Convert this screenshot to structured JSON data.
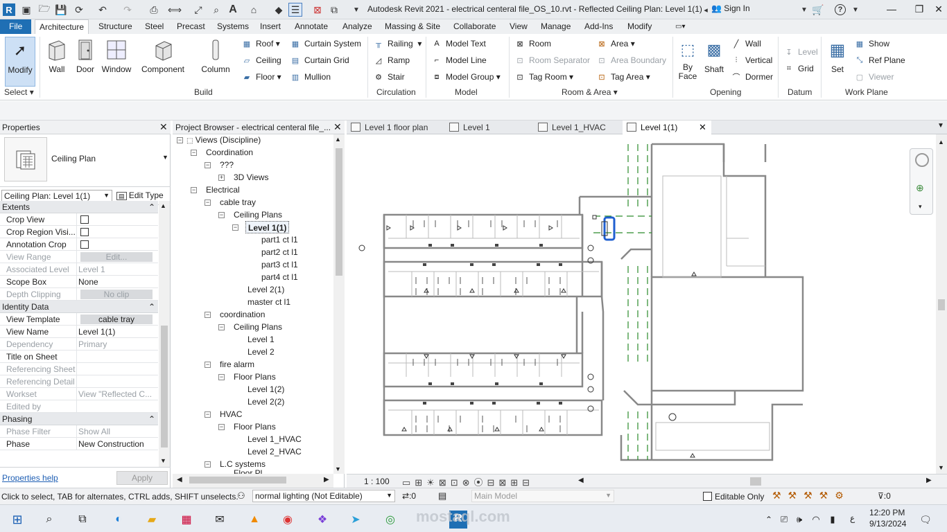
{
  "window": {
    "title": "Autodesk Revit 2021 - electrical centeral file_OS_10.rvt - Reflected Ceiling Plan: Level 1(1)",
    "signin": "Sign In"
  },
  "ribbon_tabs": [
    "File",
    "Architecture",
    "Structure",
    "Steel",
    "Precast",
    "Systems",
    "Insert",
    "Annotate",
    "Analyze",
    "Massing & Site",
    "Collaborate",
    "View",
    "Manage",
    "Add-Ins",
    "Modify"
  ],
  "ribbon": {
    "modify": "Modify",
    "select": "Select",
    "build": {
      "wall": "Wall",
      "door": "Door",
      "window": "Window",
      "component": "Component",
      "column": "Column",
      "roof": "Roof",
      "ceiling": "Ceiling",
      "floor": "Floor",
      "curtain_system": "Curtain System",
      "curtain_grid": "Curtain Grid",
      "mullion": "Mullion",
      "title": "Build"
    },
    "circulation": {
      "railing": "Railing",
      "ramp": "Ramp",
      "stair": "Stair",
      "title": "Circulation"
    },
    "model": {
      "model_text": "Model Text",
      "model_line": "Model Line",
      "model_group": "Model Group",
      "title": "Model"
    },
    "room_area": {
      "room": "Room",
      "room_separator": "Room Separator",
      "tag_room": "Tag Room",
      "area": "Area",
      "area_boundary": "Area Boundary",
      "tag_area": "Tag Area",
      "title": "Room & Area"
    },
    "opening": {
      "by_face": "By Face",
      "shaft": "Shaft",
      "wall": "Wall",
      "vertical": "Vertical",
      "dormer": "Dormer",
      "title": "Opening"
    },
    "datum": {
      "level": "Level",
      "grid": "Grid",
      "title": "Datum"
    },
    "work_plane": {
      "set": "Set",
      "show": "Show",
      "ref_plane": "Ref Plane",
      "viewer": "Viewer",
      "title": "Work Plane"
    }
  },
  "properties": {
    "title": "Properties",
    "type_name": "Ceiling Plan",
    "selector": "Ceiling Plan: Level 1(1)",
    "edit_type": "Edit Type",
    "groups": {
      "extents": "Extents",
      "identity": "Identity Data",
      "phasing": "Phasing"
    },
    "rows": {
      "crop_view": "Crop View",
      "crop_region": "Crop Region Visi...",
      "annotation_crop": "Annotation Crop",
      "view_range": "View Range",
      "view_range_v": "Edit...",
      "assoc_level": "Associated Level",
      "assoc_level_v": "Level 1",
      "scope_box": "Scope Box",
      "scope_box_v": "None",
      "depth_clip": "Depth Clipping",
      "depth_clip_v": "No clip",
      "view_template": "View Template",
      "view_template_v": "cable tray",
      "view_name": "View Name",
      "view_name_v": "Level 1(1)",
      "dependency": "Dependency",
      "dependency_v": "Primary",
      "title_on_sheet": "Title on Sheet",
      "ref_sheet": "Referencing Sheet",
      "ref_detail": "Referencing Detail",
      "workset": "Workset",
      "workset_v": "View \"Reflected C...",
      "edited_by": "Edited by",
      "phase_filter": "Phase Filter",
      "phase_filter_v": "Show All",
      "phase": "Phase",
      "phase_v": "New Construction"
    },
    "help": "Properties help",
    "apply": "Apply"
  },
  "project_browser": {
    "title": "Project Browser - electrical centeral file_...",
    "nodes": {
      "views": "Views (Discipline)",
      "coordination": "Coordination",
      "qqq": "???",
      "views3d": "3D Views",
      "electrical": "Electrical",
      "cable_tray": "cable tray",
      "ceiling_plans": "Ceiling Plans",
      "level11": "Level 1(1)",
      "part1": "part1 ct l1",
      "part2": "part2 ct l1",
      "part3": "part3 ct l1",
      "part4": "part4 ct l1",
      "level21": "Level 2(1)",
      "master": "master ct l1",
      "coordination2": "coordination",
      "ceiling_plans2": "Ceiling Plans",
      "level1": "Level 1",
      "level2": "Level 2",
      "fire_alarm": "fire alarm",
      "floor_plans": "Floor Plans",
      "level12": "Level 1(2)",
      "level22": "Level 2(2)",
      "hvac": "HVAC",
      "floor_plans2": "Floor Plans",
      "level1_hvac": "Level 1_HVAC",
      "level2_hvac": "Level 2_HVAC",
      "lc_systems": "L.C systems",
      "floor_pl": "Floor Pl..."
    }
  },
  "view_tabs": [
    "Level 1 floor plan",
    "Level 1",
    "Level 1_HVAC",
    "Level 1(1)"
  ],
  "view_scale": "1 : 100",
  "status": {
    "hint": "Click to select, TAB for alternates, CTRL adds, SHIFT unselects.",
    "lighting": "normal lighting (Not Editable)",
    "count0": ":0",
    "main_model": "Main Model",
    "editable_only": "Editable Only",
    "filter0": ":0"
  },
  "taskbar": {
    "time": "12:20 PM",
    "date": "9/13/2024",
    "lang": "ع"
  },
  "watermark": "mostaql.com"
}
